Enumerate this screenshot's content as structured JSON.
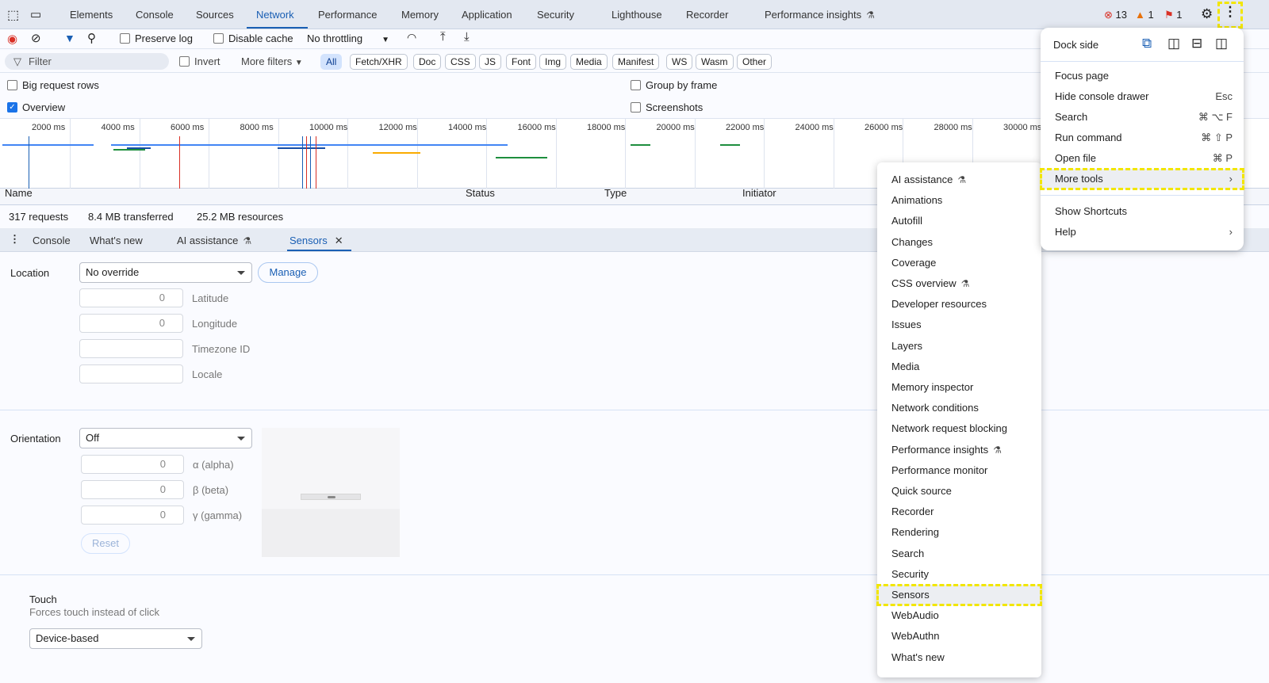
{
  "top_tabs": [
    "Elements",
    "Console",
    "Sources",
    "Network",
    "Performance",
    "Memory",
    "Application",
    "Security",
    "Lighthouse",
    "Recorder",
    "Performance insights"
  ],
  "active_tab": "Network",
  "status": {
    "errors": "13",
    "warnings": "1",
    "issues": "1"
  },
  "toolbar": {
    "preserve_log": "Preserve log",
    "disable_cache": "Disable cache",
    "throttling": "No throttling"
  },
  "filter": {
    "placeholder": "Filter",
    "invert": "Invert",
    "more_filters": "More filters",
    "chips": [
      "All",
      "Fetch/XHR",
      "Doc",
      "CSS",
      "JS",
      "Font",
      "Img",
      "Media",
      "Manifest",
      "WS",
      "Wasm",
      "Other"
    ]
  },
  "options": {
    "big_rows": "Big request rows",
    "overview": "Overview",
    "group_by_frame": "Group by frame",
    "screenshots": "Screenshots"
  },
  "overview_ticks": [
    "2000 ms",
    "4000 ms",
    "6000 ms",
    "8000 ms",
    "10000 ms",
    "12000 ms",
    "14000 ms",
    "16000 ms",
    "18000 ms",
    "20000 ms",
    "22000 ms",
    "24000 ms",
    "26000 ms",
    "28000 ms",
    "30000 ms"
  ],
  "columns": {
    "name": "Name",
    "status": "Status",
    "type": "Type",
    "initiator": "Initiator"
  },
  "summary": {
    "requests": "317 requests",
    "transferred": "8.4 MB transferred",
    "resources": "25.2 MB resources"
  },
  "drawer_tabs": [
    "Console",
    "What's new",
    "AI assistance",
    "Sensors"
  ],
  "sensors": {
    "location_label": "Location",
    "location_value": "No override",
    "manage": "Manage",
    "lat_value": "0",
    "lat_label": "Latitude",
    "lon_value": "0",
    "lon_label": "Longitude",
    "tz_label": "Timezone ID",
    "locale_label": "Locale",
    "orientation_label": "Orientation",
    "orientation_value": "Off",
    "alpha_value": "0",
    "alpha_label": "α (alpha)",
    "beta_value": "0",
    "beta_label": "β (beta)",
    "gamma_value": "0",
    "gamma_label": "γ (gamma)",
    "reset": "Reset",
    "touch_label": "Touch",
    "touch_desc": "Forces touch instead of click",
    "touch_value": "Device-based"
  },
  "main_menu": {
    "dock_side": "Dock side",
    "items": [
      {
        "label": "Focus page",
        "shortcut": ""
      },
      {
        "label": "Hide console drawer",
        "shortcut": "Esc"
      },
      {
        "label": "Search",
        "shortcut": "⌘ ⌥ F"
      },
      {
        "label": "Run command",
        "shortcut": "⌘ ⇧ P"
      },
      {
        "label": "Open file",
        "shortcut": "⌘ P"
      },
      {
        "label": "More tools",
        "shortcut": "›"
      },
      {
        "label": "Show Shortcuts",
        "shortcut": ""
      },
      {
        "label": "Help",
        "shortcut": "›"
      }
    ]
  },
  "more_tools": [
    "AI assistance",
    "Animations",
    "Autofill",
    "Changes",
    "Coverage",
    "CSS overview",
    "Developer resources",
    "Issues",
    "Layers",
    "Media",
    "Memory inspector",
    "Network conditions",
    "Network request blocking",
    "Performance insights",
    "Performance monitor",
    "Quick source",
    "Recorder",
    "Rendering",
    "Search",
    "Security",
    "Sensors",
    "WebAudio",
    "WebAuthn",
    "What's new"
  ],
  "highlight_color": "#f2e600",
  "accent": "#1a5fb4"
}
